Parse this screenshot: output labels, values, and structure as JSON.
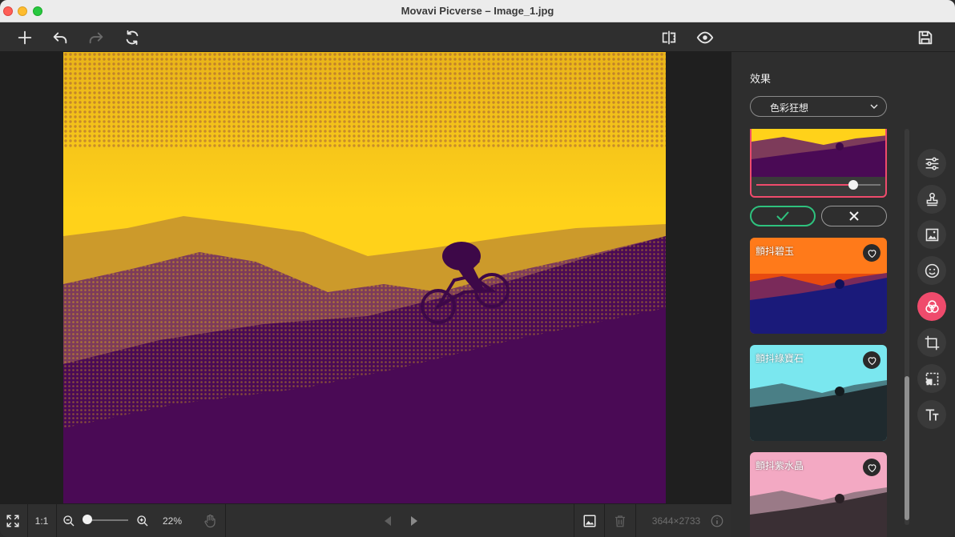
{
  "window": {
    "title": "Movavi Picverse – Image_1.jpg"
  },
  "toolbar": {
    "left_icons": [
      "plus-icon",
      "undo-icon",
      "redo-icon",
      "refresh-icon"
    ],
    "center_icons": [
      "compare-icon",
      "preview-eye-icon"
    ],
    "right_icons": [
      "save-icon"
    ]
  },
  "bottombar": {
    "fit_label": "1:1",
    "zoom_value": "22%",
    "zoom_slider_fraction": 0.05,
    "image_size": "3644×2733"
  },
  "panel": {
    "title": "效果",
    "category": "色彩狂想",
    "effects": [
      {
        "label": "顫抖碧玉"
      },
      {
        "label": "顫抖綠寶石"
      },
      {
        "label": "顫抖紫水晶"
      }
    ],
    "intensity_fraction": 0.78
  },
  "rail": {
    "tools": [
      "adjust-icon",
      "stamp-icon",
      "image-icon",
      "sticker-icon",
      "effects-icon",
      "crop-icon",
      "transform-icon",
      "text-icon"
    ],
    "active": "effects-icon"
  },
  "colors": {
    "accent": "#ef4b6c",
    "confirm": "#2ec27e",
    "photo_yellow": "#ffd21a",
    "photo_purple": "#4a0a55"
  }
}
